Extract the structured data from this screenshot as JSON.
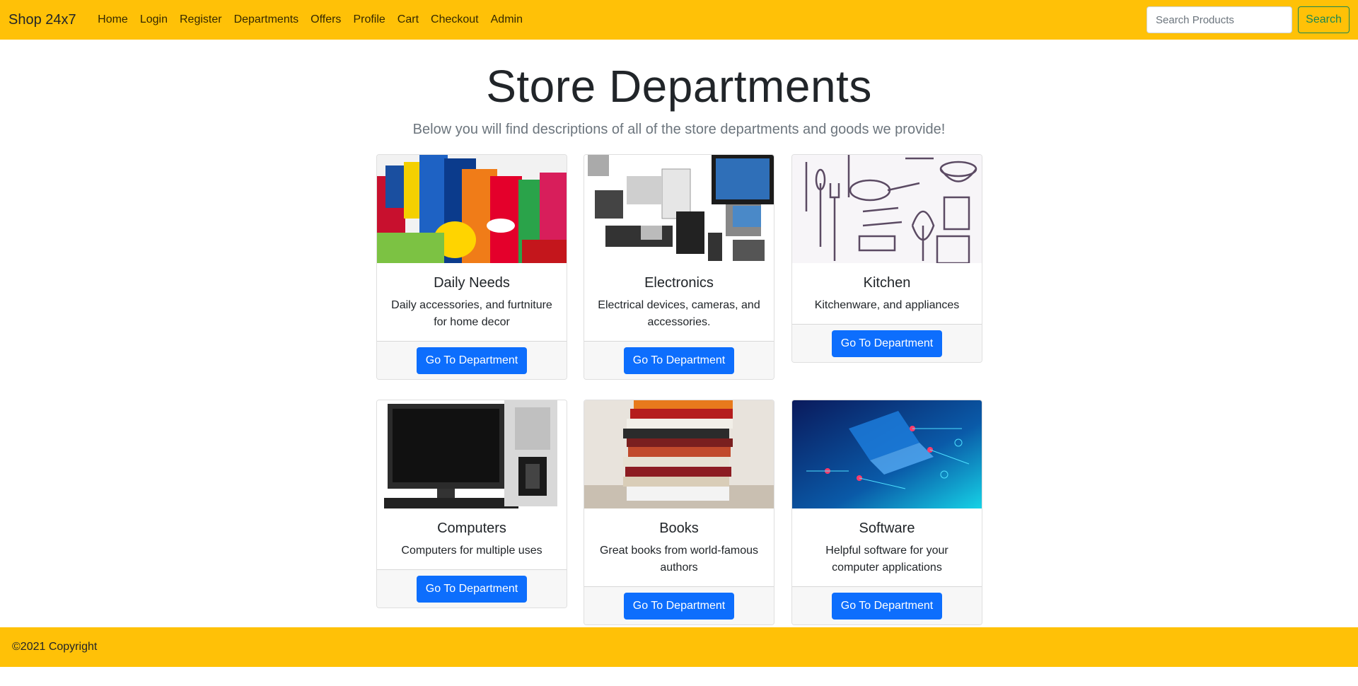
{
  "nav": {
    "brand": "Shop 24x7",
    "links": [
      "Home",
      "Login",
      "Register",
      "Departments",
      "Offers",
      "Profile",
      "Cart",
      "Checkout",
      "Admin"
    ],
    "search_placeholder": "Search Products",
    "search_button": "Search"
  },
  "hero": {
    "title": "Store Departments",
    "subtitle": "Below you will find descriptions of all of the store departments and goods we provide!"
  },
  "departments": [
    {
      "title": "Daily Needs",
      "text": "Daily accessories, and furtniture for home decor",
      "button": "Go To Department",
      "image": "daily-needs-products-image"
    },
    {
      "title": "Electronics",
      "text": "Electrical devices, cameras, and accessories.",
      "button": "Go To Department",
      "image": "electronics-devices-image"
    },
    {
      "title": "Kitchen",
      "text": "Kitchenware, and appliances",
      "button": "Go To Department",
      "image": "kitchen-utensils-sketch-image"
    },
    {
      "title": "Computers",
      "text": "Computers for multiple uses",
      "button": "Go To Department",
      "image": "desktop-computer-image"
    },
    {
      "title": "Books",
      "text": "Great books from world-famous authors",
      "button": "Go To Department",
      "image": "book-stack-image"
    },
    {
      "title": "Software",
      "text": "Helpful software for your computer applications",
      "button": "Go To Department",
      "image": "software-laptop-circuit-image"
    }
  ],
  "footer": {
    "copyright": "©2021 Copyright"
  },
  "colors": {
    "navbar": "#ffc107",
    "primary_button": "#0d6efd",
    "search_button": "#198754"
  }
}
